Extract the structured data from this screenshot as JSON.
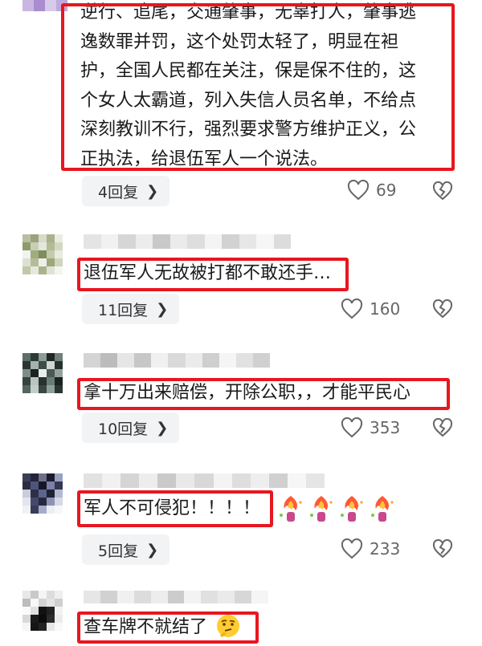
{
  "comments": [
    {
      "text_lines": [
        "逆行、追尾，交通肇事，无辜打人，肇事逃",
        "逸数罪并罚，这个处罚太轻了，明显在袒",
        "护，全国人民都在关注，保是保不住的，这",
        "个女人太霸道，列入失信人员名单，不给点",
        "深刻教训不行，强烈要求警方维护正义，公",
        "正执法，给退伍军人一个说法。"
      ],
      "replies_label": "4回复",
      "likes": "69"
    },
    {
      "text": "退伍军人无故被打都不敢还手…",
      "replies_label": "11回复",
      "likes": "160"
    },
    {
      "text": "拿十万出来赔偿，开除公职，，才能平民心",
      "replies_label": "10回复",
      "likes": "353"
    },
    {
      "text": "军人不可侵犯！！！！",
      "emoji": "torch-fire-emoji",
      "replies_label": "5回复",
      "likes": "233"
    },
    {
      "text": "查车牌不就结了",
      "emoji": "thinking-face-emoji"
    }
  ],
  "icons": {
    "like": "heart-outline-icon",
    "dislike": "broken-heart-icon",
    "chevron": "chevron-right-icon"
  },
  "colors": {
    "highlight_red": "#e8161f",
    "pill_bg": "#f2f3f5"
  }
}
